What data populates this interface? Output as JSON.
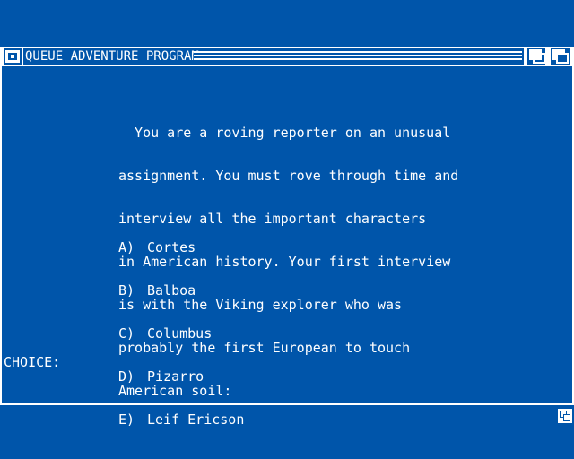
{
  "window": {
    "title": "QUEUE ADVENTURE PROGRAM"
  },
  "story": {
    "lines": [
      "  You are a roving reporter on an unusual",
      "assignment. You must rove through time and",
      "interview all the important characters",
      "in American history. Your first interview",
      "is with the Viking explorer who was",
      "probably the first European to touch",
      "American soil:"
    ]
  },
  "options": [
    {
      "letter": "A)",
      "text": "Cortes"
    },
    {
      "letter": "B)",
      "text": "Balboa"
    },
    {
      "letter": "C)",
      "text": "Columbus"
    },
    {
      "letter": "D)",
      "text": "Pizarro"
    },
    {
      "letter": "E)",
      "text": "Leif Ericson"
    }
  ],
  "prompt": {
    "label": "CHOICE:"
  },
  "colors": {
    "background": "#0055aa",
    "foreground": "#ffffff"
  },
  "icons": {
    "close": "close-gadget-icon",
    "depth_back": "depth-back-icon",
    "depth_front": "depth-front-icon",
    "resize": "resize-icon"
  }
}
